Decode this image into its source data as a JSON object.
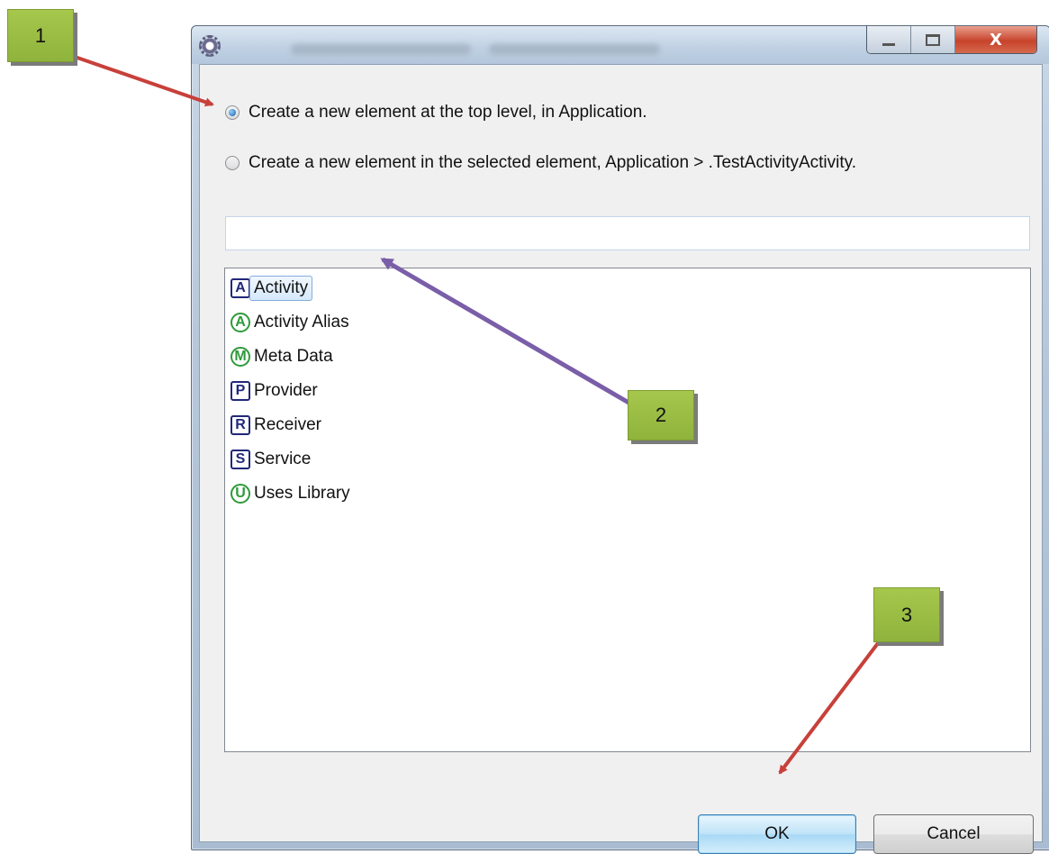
{
  "options": [
    {
      "label": "Create a new element at the top level, in Application.",
      "checked": true
    },
    {
      "label": "Create a new element in the selected element, Application > .TestActivityActivity.",
      "checked": false
    }
  ],
  "filter": {
    "value": ""
  },
  "items": [
    {
      "letter": "A",
      "label": "Activity",
      "shape": "square",
      "color": "#21287a",
      "selected": true
    },
    {
      "letter": "A",
      "label": "Activity Alias",
      "shape": "circle",
      "color": "#2e9a3a",
      "selected": false
    },
    {
      "letter": "M",
      "label": "Meta Data",
      "shape": "circle",
      "color": "#2e9a3a",
      "selected": false
    },
    {
      "letter": "P",
      "label": "Provider",
      "shape": "square",
      "color": "#21287a",
      "selected": false
    },
    {
      "letter": "R",
      "label": "Receiver",
      "shape": "square",
      "color": "#21287a",
      "selected": false
    },
    {
      "letter": "S",
      "label": "Service",
      "shape": "square",
      "color": "#21287a",
      "selected": false
    },
    {
      "letter": "U",
      "label": "Uses Library",
      "shape": "circle",
      "color": "#2e9a3a",
      "selected": false
    }
  ],
  "buttons": {
    "ok": "OK",
    "cancel": "Cancel"
  },
  "window_controls": {
    "close": "X"
  },
  "callouts": {
    "one": "1",
    "two": "2",
    "three": "3"
  },
  "colors": {
    "callout": "#9bbd44",
    "arrow_red": "#c8403a",
    "arrow_purple": "#7a5ea8"
  }
}
